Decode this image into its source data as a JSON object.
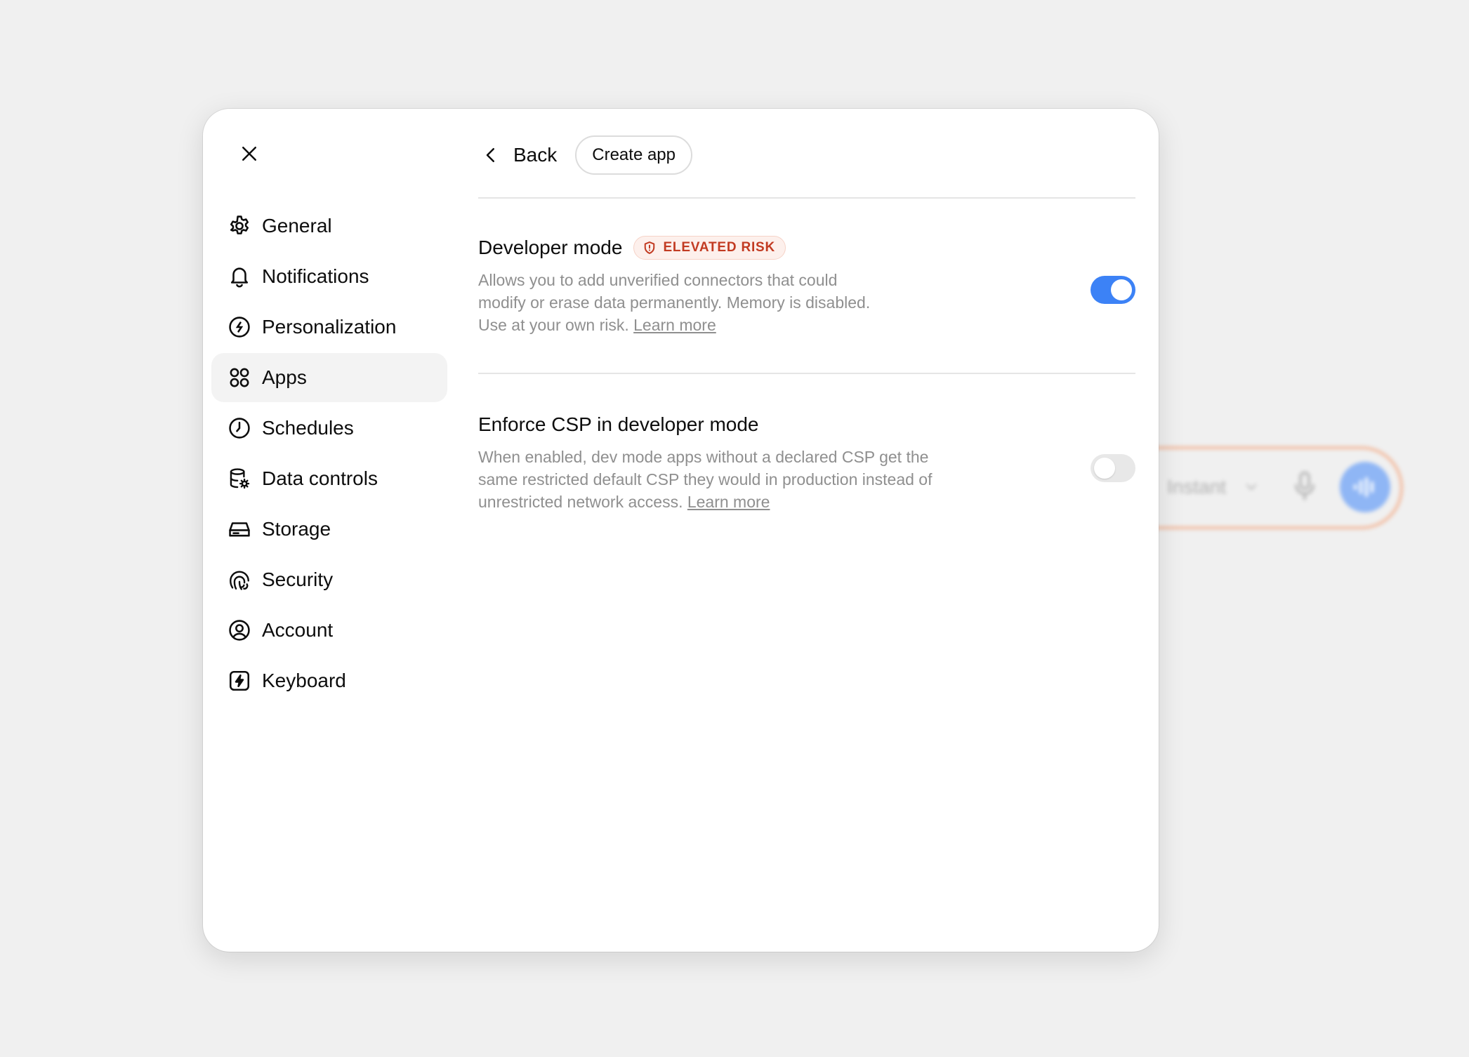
{
  "background_composer": {
    "model_label": "Instant"
  },
  "modal": {
    "sidebar": {
      "items": [
        {
          "id": "general",
          "label": "General",
          "icon": "gear-icon"
        },
        {
          "id": "notifications",
          "label": "Notifications",
          "icon": "bell-icon"
        },
        {
          "id": "personalization",
          "label": "Personalization",
          "icon": "personalization-icon"
        },
        {
          "id": "apps",
          "label": "Apps",
          "icon": "apps-grid-icon",
          "active": true
        },
        {
          "id": "schedules",
          "label": "Schedules",
          "icon": "clock-icon"
        },
        {
          "id": "data-controls",
          "label": "Data controls",
          "icon": "database-gear-icon"
        },
        {
          "id": "storage",
          "label": "Storage",
          "icon": "drive-icon"
        },
        {
          "id": "security",
          "label": "Security",
          "icon": "fingerprint-icon"
        },
        {
          "id": "account",
          "label": "Account",
          "icon": "user-circle-icon"
        },
        {
          "id": "keyboard",
          "label": "Keyboard",
          "icon": "lightning-key-icon"
        }
      ]
    },
    "header": {
      "back_label": "Back",
      "create_app_label": "Create app"
    },
    "settings": [
      {
        "title": "Developer mode",
        "badge": "ELEVATED RISK",
        "description": "Allows you to add unverified connectors that could modify or erase data permanently. Memory is disabled. Use at your own risk.",
        "link": "Learn more",
        "enabled": true
      },
      {
        "title": "Enforce CSP in developer mode",
        "description": "When enabled, dev mode apps without a declared CSP get the same restricted default CSP they would in production instead of unrestricted network access.",
        "link": "Learn more",
        "enabled": false
      }
    ]
  },
  "colors": {
    "toggle_on": "#3c82f6",
    "badge_text": "#c23b22",
    "badge_bg": "#fdf0ec"
  }
}
